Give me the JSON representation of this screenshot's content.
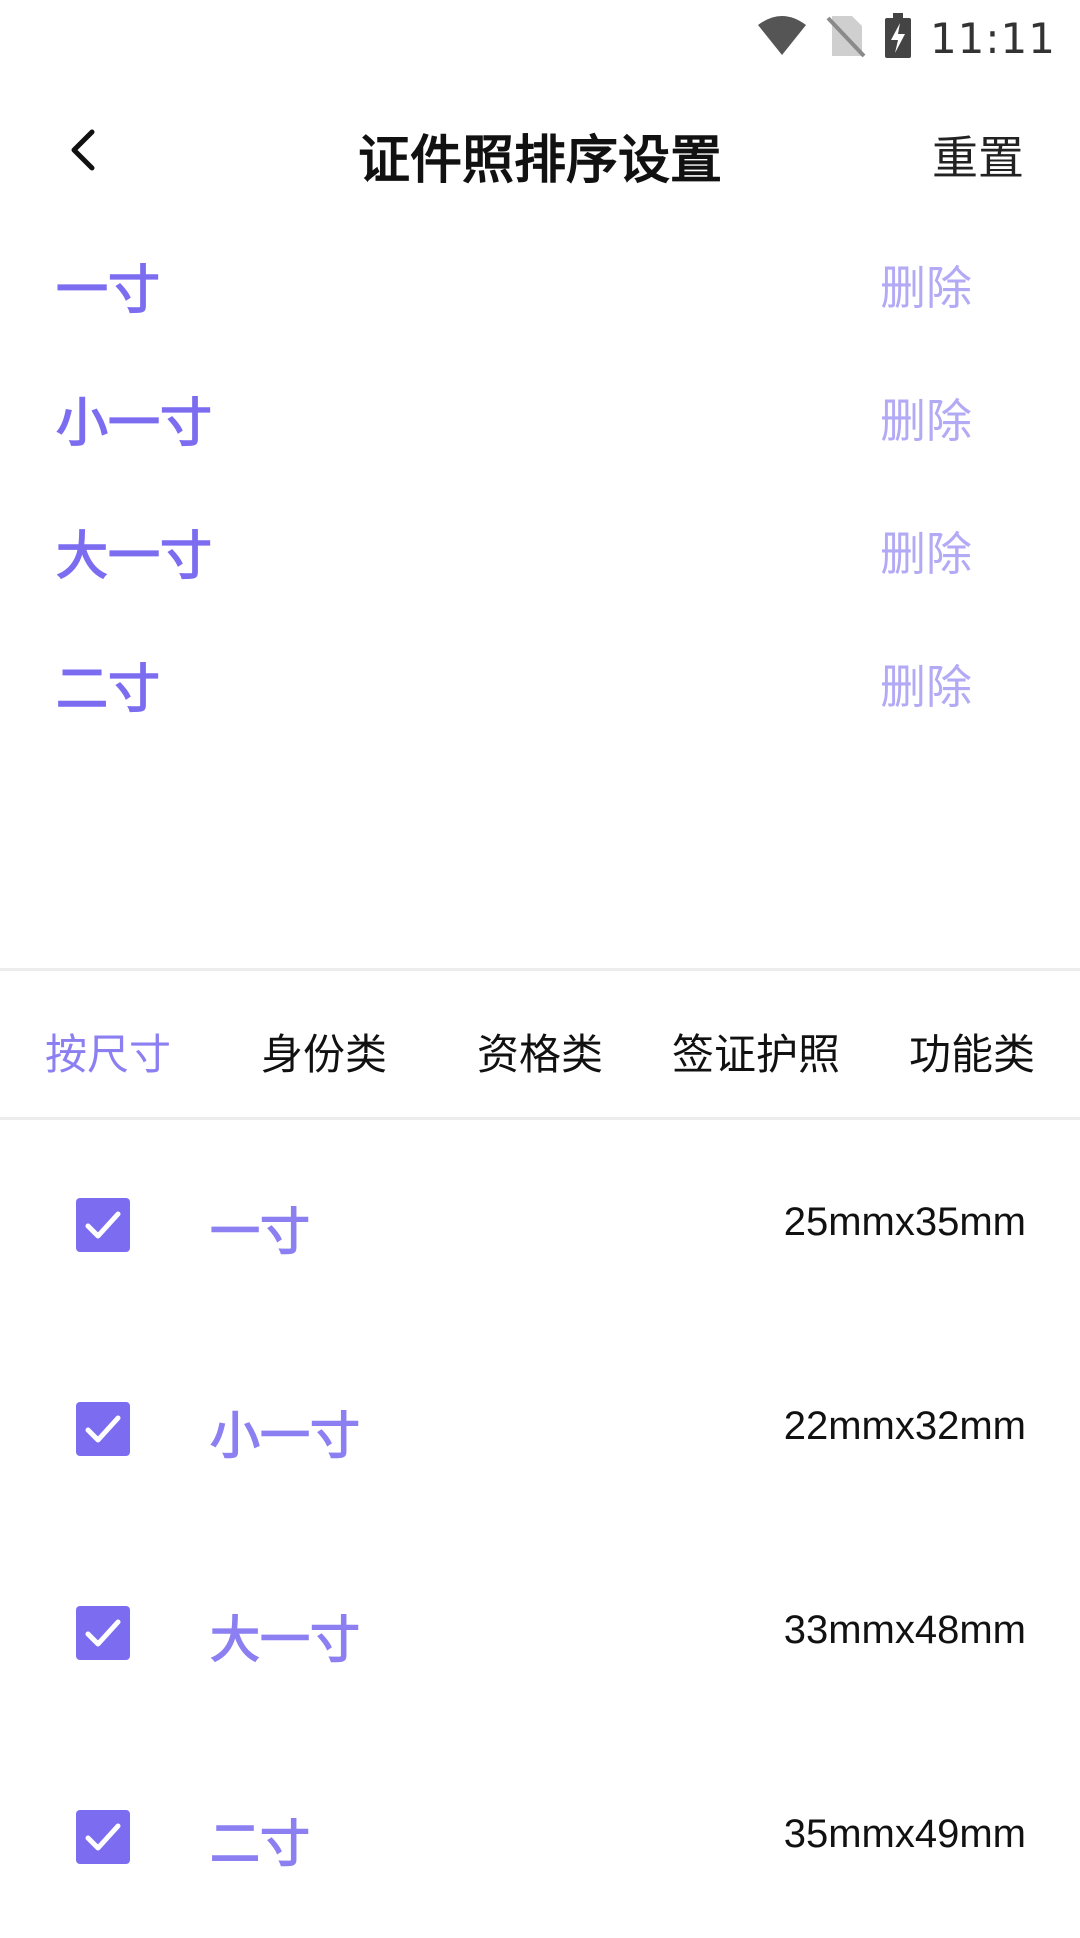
{
  "status_bar": {
    "time": "11:11",
    "icons": [
      "wifi-icon",
      "no-sim-icon",
      "battery-charging-icon"
    ]
  },
  "header": {
    "title": "证件照排序设置",
    "reset_label": "重置",
    "back_icon": "chevron-left-icon"
  },
  "sort_list": [
    {
      "label": "一寸",
      "delete_label": "删除"
    },
    {
      "label": "小一寸",
      "delete_label": "删除"
    },
    {
      "label": "大一寸",
      "delete_label": "删除"
    },
    {
      "label": "二寸",
      "delete_label": "删除"
    }
  ],
  "tabs": [
    {
      "label": "按尺寸",
      "active": true
    },
    {
      "label": "身份类",
      "active": false
    },
    {
      "label": "资格类",
      "active": false
    },
    {
      "label": "签证护照",
      "active": false
    },
    {
      "label": "功能类",
      "active": false
    }
  ],
  "size_list": [
    {
      "name": "一寸",
      "dimensions": "25mmx35mm",
      "checked": true
    },
    {
      "name": "小一寸",
      "dimensions": "22mmx32mm",
      "checked": true
    },
    {
      "name": "大一寸",
      "dimensions": "33mmx48mm",
      "checked": true
    },
    {
      "name": "二寸",
      "dimensions": "35mmx49mm",
      "checked": true
    }
  ],
  "colors": {
    "accent": "#7b6cf0",
    "accent_light": "#b3aaf6",
    "text": "#111111",
    "divider": "#ededed"
  }
}
